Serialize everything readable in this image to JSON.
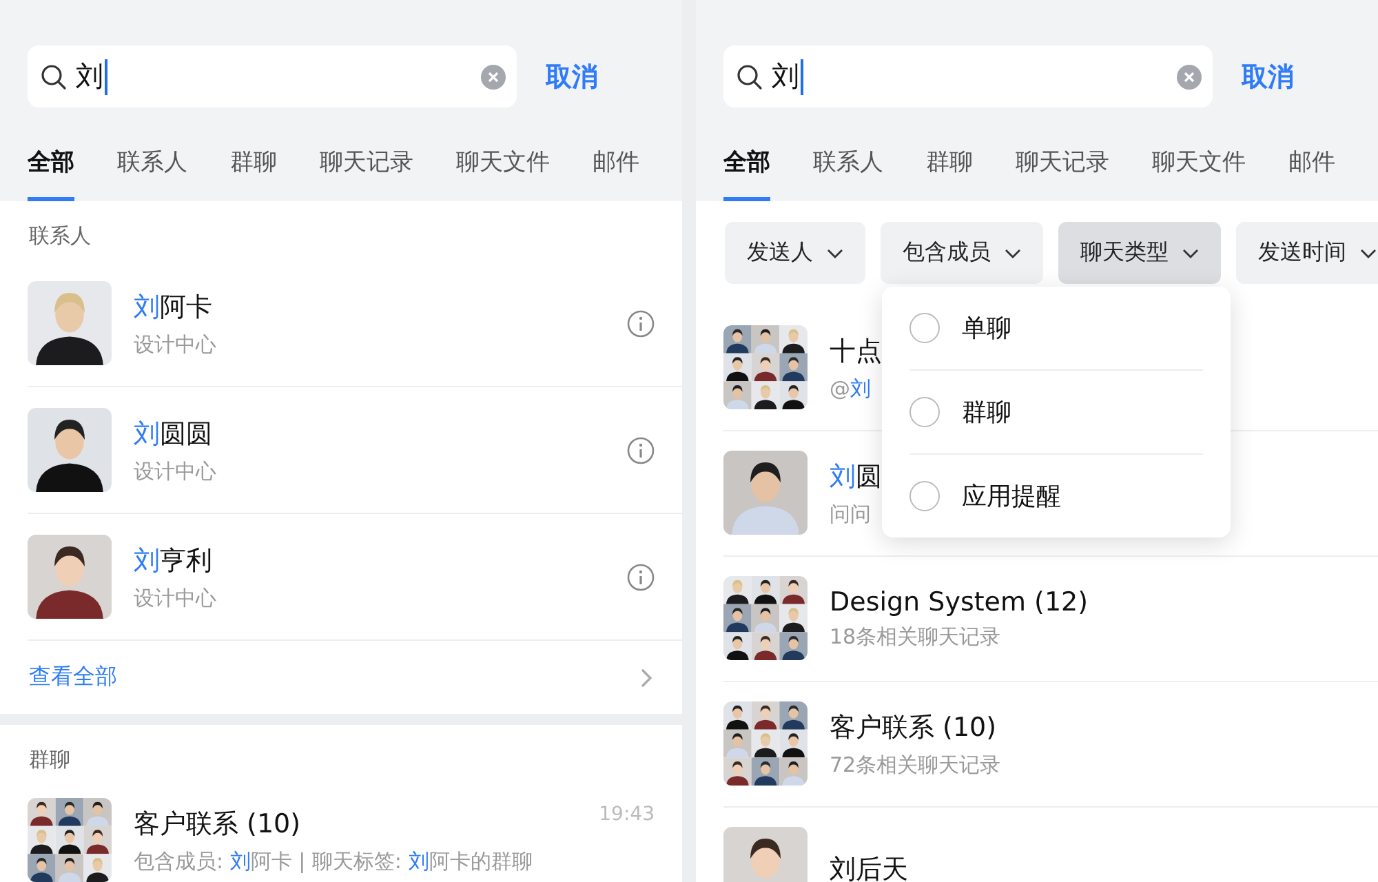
{
  "panels": [
    {
      "search": {
        "value": "刘"
      },
      "cancel": "取消",
      "tabs": [
        {
          "label": "全部",
          "selected": true
        },
        {
          "label": "联系人",
          "selected": false
        },
        {
          "label": "群聊",
          "selected": false
        },
        {
          "label": "聊天记录",
          "selected": false
        },
        {
          "label": "聊天文件",
          "selected": false
        },
        {
          "label": "邮件",
          "selected": false
        }
      ],
      "sections": [
        {
          "title": "联系人",
          "more": "查看全部",
          "items": [
            {
              "kind": "contact",
              "name": [
                {
                  "text": "刘",
                  "match": true
                },
                {
                  "text": "阿卡",
                  "match": false
                }
              ],
              "sub": [
                {
                  "text": "设计中心",
                  "match": false
                }
              ]
            },
            {
              "kind": "contact",
              "name": [
                {
                  "text": "刘",
                  "match": true
                },
                {
                  "text": "圆圆",
                  "match": false
                }
              ],
              "sub": [
                {
                  "text": "设计中心",
                  "match": false
                }
              ]
            },
            {
              "kind": "contact",
              "name": [
                {
                  "text": "刘",
                  "match": true
                },
                {
                  "text": "亨利",
                  "match": false
                }
              ],
              "sub": [
                {
                  "text": "设计中心",
                  "match": false
                }
              ]
            }
          ]
        },
        {
          "title": "群聊",
          "items": [
            {
              "kind": "group",
              "time": "19:43",
              "name": [
                {
                  "text": "客户联系 (10)",
                  "match": false
                }
              ],
              "sub": [
                {
                  "text": "包含成员: ",
                  "match": false
                },
                {
                  "text": "刘",
                  "match": true
                },
                {
                  "text": "阿卡",
                  "match": false
                },
                {
                  "text": " | ",
                  "match": false
                },
                {
                  "text": "聊天标签: ",
                  "match": false
                },
                {
                  "text": "刘",
                  "match": true
                },
                {
                  "text": "阿卡的群聊",
                  "match": false
                }
              ]
            }
          ]
        }
      ]
    },
    {
      "search": {
        "value": "刘"
      },
      "cancel": "取消",
      "tabs": [
        {
          "label": "全部",
          "selected": true
        },
        {
          "label": "联系人",
          "selected": false
        },
        {
          "label": "群聊",
          "selected": false
        },
        {
          "label": "聊天记录",
          "selected": false
        },
        {
          "label": "聊天文件",
          "selected": false
        },
        {
          "label": "邮件",
          "selected": false
        }
      ],
      "filters": [
        {
          "label": "发送人",
          "selected": false
        },
        {
          "label": "包含成员",
          "selected": false
        },
        {
          "label": "聊天类型",
          "selected": true
        },
        {
          "label": "发送时间",
          "selected": false
        }
      ],
      "dropdown": [
        {
          "label": "单聊",
          "checked": false
        },
        {
          "label": "群聊",
          "checked": false
        },
        {
          "label": "应用提醒",
          "checked": false
        }
      ],
      "results": [
        {
          "kind": "group",
          "name": [
            {
              "text": "十点",
              "match": false
            }
          ],
          "sub": [
            {
              "text": "@",
              "match": false
            },
            {
              "text": "刘",
              "match": true
            }
          ]
        },
        {
          "kind": "person",
          "name": [
            {
              "text": "刘",
              "match": true
            },
            {
              "text": "圆",
              "match": false
            }
          ],
          "sub": [
            {
              "text": "问问",
              "match": false
            }
          ]
        },
        {
          "kind": "group",
          "name": [
            {
              "text": "Design System (12)",
              "match": false
            }
          ],
          "sub": [
            {
              "text": "18条相关聊天记录",
              "match": false
            }
          ]
        },
        {
          "kind": "group",
          "name": [
            {
              "text": "客户联系 (10)",
              "match": false
            }
          ],
          "sub": [
            {
              "text": "72条相关聊天记录",
              "match": false
            }
          ]
        },
        {
          "kind": "person",
          "name": [
            {
              "text": "刘后天",
              "match": false
            }
          ]
        }
      ]
    }
  ]
}
